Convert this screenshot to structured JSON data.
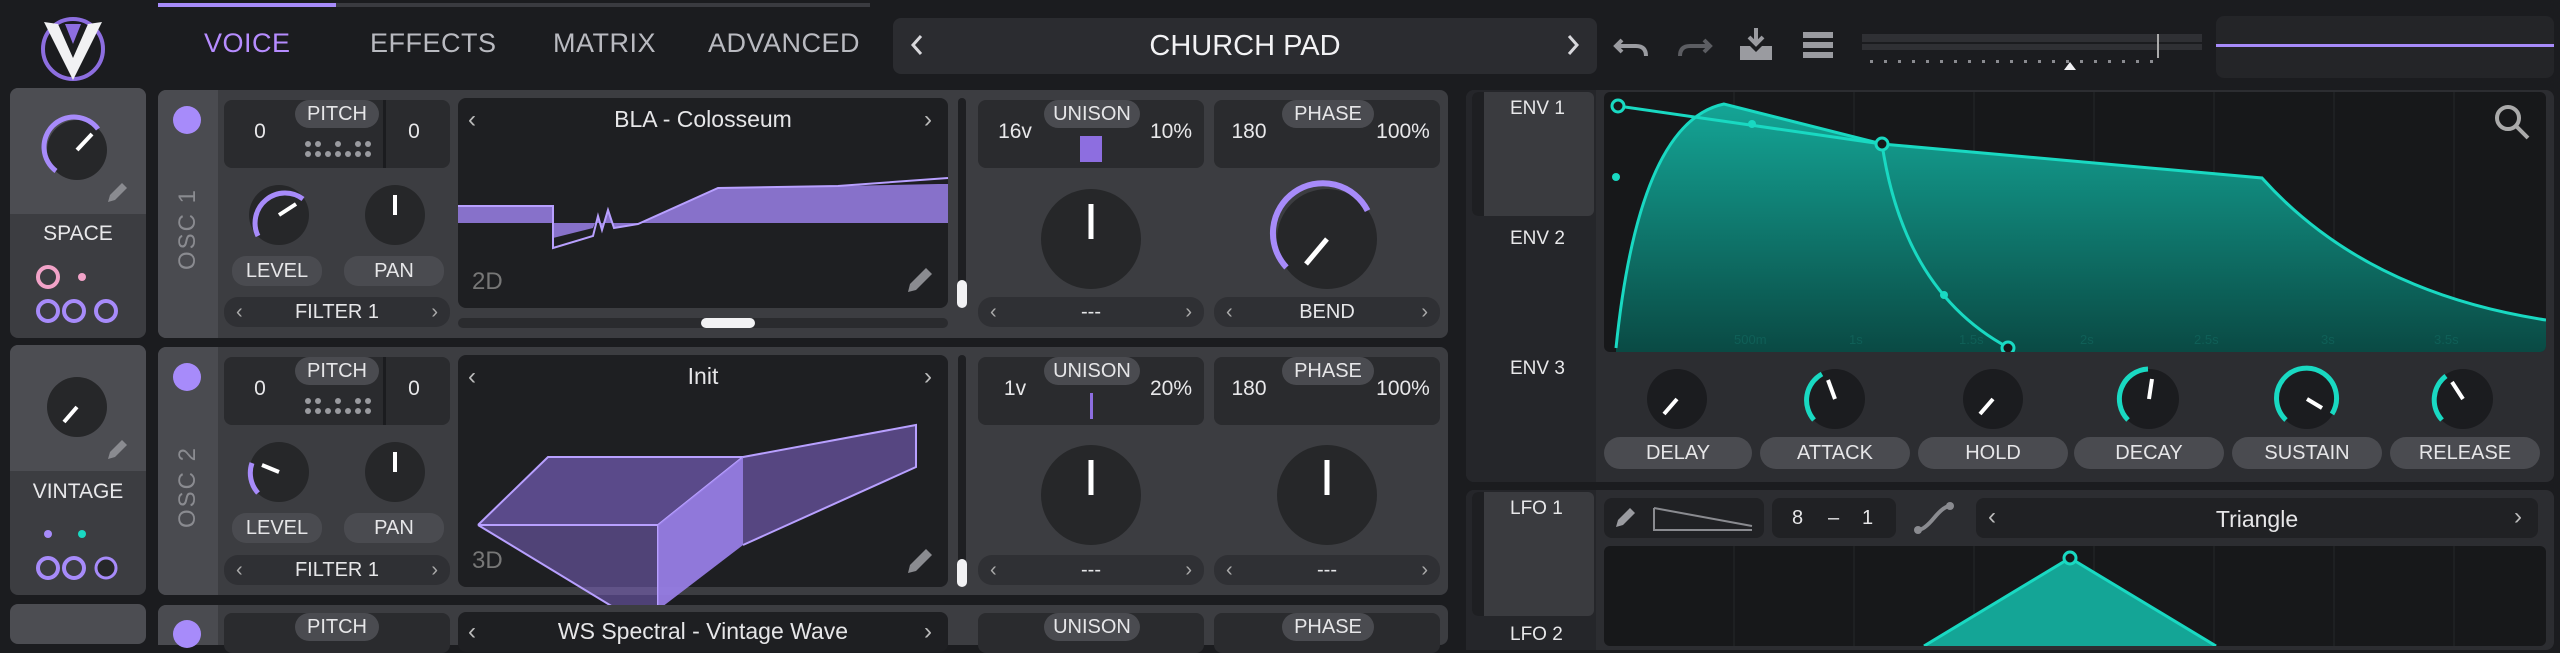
{
  "colors": {
    "accent": "#a78bfa",
    "teal": "#19d9c2",
    "panel": "#3c3d41",
    "dark": "#1e1f22"
  },
  "tabs": [
    "VOICE",
    "EFFECTS",
    "MATRIX",
    "ADVANCED"
  ],
  "preset": {
    "name": "CHURCH PAD"
  },
  "icons": [
    "logo-v",
    "chevron-left-icon",
    "chevron-right-icon",
    "undo-icon",
    "redo-icon",
    "save-icon",
    "menu-icon",
    "magnifier-icon",
    "edit-icon",
    "curve-icon",
    "pencil-icon"
  ],
  "macros": [
    {
      "label": "SPACE"
    },
    {
      "label": "VINTAGE"
    }
  ],
  "osc": [
    {
      "title": "OSC 1",
      "pitch_label": "PITCH",
      "pitch_oct": "0",
      "pitch_semi": "0",
      "level_label": "LEVEL",
      "pan_label": "PAN",
      "filter": "FILTER 1",
      "wavetable": "BLA - Colosseum",
      "view": "2D",
      "unison_label": "UNISON",
      "unison_voices": "16v",
      "unison_amount": "10%",
      "phase_label": "PHASE",
      "phase_value": "180",
      "phase_amount": "100%",
      "unison_mode": "---",
      "phase_mode": "BEND"
    },
    {
      "title": "OSC 2",
      "pitch_label": "PITCH",
      "pitch_oct": "0",
      "pitch_semi": "0",
      "level_label": "LEVEL",
      "pan_label": "PAN",
      "filter": "FILTER 1",
      "wavetable": "Init",
      "view": "3D",
      "unison_label": "UNISON",
      "unison_voices": "1v",
      "unison_amount": "20%",
      "phase_label": "PHASE",
      "phase_value": "180",
      "phase_amount": "100%",
      "unison_mode": "---",
      "phase_mode": "---"
    },
    {
      "pitch_label": "PITCH",
      "wavetable": "WS Spectral - Vintage Wave",
      "unison_label": "UNISON",
      "phase_label": "PHASE"
    }
  ],
  "envelopes": {
    "tabs": [
      "ENV 1",
      "ENV 2",
      "ENV 3"
    ],
    "time_labels": [
      "500m",
      "1s",
      "1.5s",
      "2s",
      "2.5s",
      "3s",
      "3.5s"
    ],
    "knobs": [
      "DELAY",
      "ATTACK",
      "HOLD",
      "DECAY",
      "SUSTAIN",
      "RELEASE"
    ]
  },
  "lfo": {
    "tabs": [
      "LFO 1",
      "LFO 2"
    ],
    "rate_num": "8",
    "rate_sep": "–",
    "rate_den": "1",
    "shape": "Triangle"
  }
}
